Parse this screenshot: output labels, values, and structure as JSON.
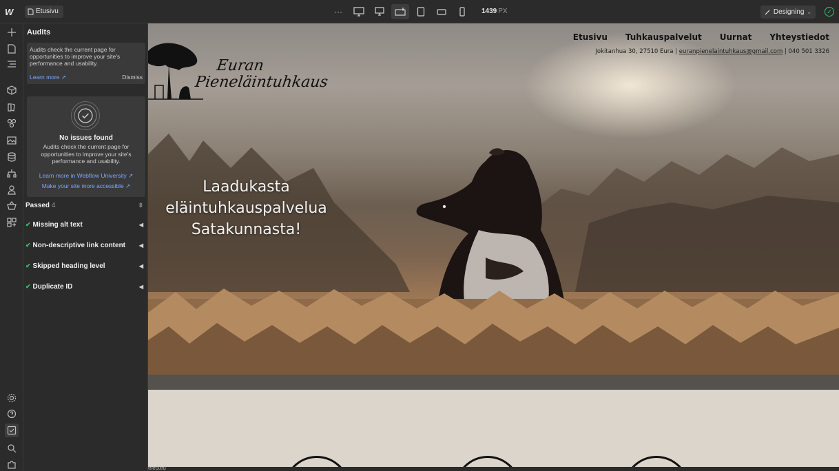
{
  "topbar": {
    "logo": "W",
    "page_name": "Etusivu",
    "more_label": "···",
    "width_value": "1439",
    "width_unit": "PX",
    "mode_label": "Designing"
  },
  "panel": {
    "title": "Audits",
    "info_text": "Audits check the current page for opportunities to improve your site's performance and usability.",
    "learn_more": "Learn more ↗",
    "dismiss": "Dismiss",
    "status_title": "No issues found",
    "status_desc": "Audits check the current page for opportunities to improve your site's performance and usability.",
    "link_university": "Learn more in Webflow University ↗",
    "link_accessible": "Make your site more accessible ↗",
    "passed_label": "Passed",
    "passed_count": "4",
    "checks": [
      {
        "label": "Missing alt text"
      },
      {
        "label": "Non-descriptive link content"
      },
      {
        "label": "Skipped heading level"
      },
      {
        "label": "Duplicate ID"
      }
    ]
  },
  "site": {
    "logo_line1": "Euran",
    "logo_line2": "Pieneläintuhkaus",
    "nav": [
      "Etusivu",
      "Tuhkauspalvelut",
      "Uurnat",
      "Yhteystiedot"
    ],
    "address": "Jokitanhua 30, 27510 Eura",
    "separator": " | ",
    "email": "euranpienelaintuhkaus@gmail.com",
    "phone": "040 501 3326",
    "headline_1": "Laadukasta",
    "headline_2": "eläintuhkauspalvelua",
    "headline_3": "Satakunnasta!"
  },
  "statusbar": {
    "text": "elected"
  },
  "colors": {
    "accent_green": "#3fbf6a",
    "link_blue": "#79a6ff"
  }
}
